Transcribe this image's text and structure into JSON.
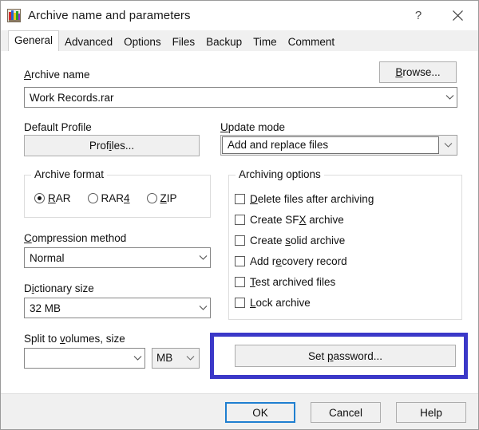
{
  "window": {
    "title": "Archive name and parameters",
    "icon": "winrar-books-icon",
    "help_button": "?",
    "close_button": "✕"
  },
  "tabs": [
    {
      "label": "General",
      "selected": true
    },
    {
      "label": "Advanced",
      "selected": false
    },
    {
      "label": "Options",
      "selected": false
    },
    {
      "label": "Files",
      "selected": false
    },
    {
      "label": "Backup",
      "selected": false
    },
    {
      "label": "Time",
      "selected": false
    },
    {
      "label": "Comment",
      "selected": false
    }
  ],
  "general": {
    "archive_name_label": "Archive name",
    "archive_name_value": "Work Records.rar",
    "browse_button": "Browse...",
    "default_profile_label": "Default Profile",
    "profiles_button": "Profiles...",
    "update_mode_label": "Update mode",
    "update_mode_value": "Add and replace files",
    "archive_format_group": "Archive format",
    "archive_format_options": [
      {
        "label": "RAR",
        "selected": true
      },
      {
        "label": "RAR4",
        "selected": false
      },
      {
        "label": "ZIP",
        "selected": false
      }
    ],
    "compression_method_label": "Compression method",
    "compression_method_value": "Normal",
    "dictionary_size_label": "Dictionary size",
    "dictionary_size_value": "32 MB",
    "split_volumes_label": "Split to volumes, size",
    "split_volumes_value": "",
    "split_volumes_unit": "MB",
    "archiving_options_group": "Archiving options",
    "archiving_options": [
      {
        "label": "Delete files after archiving",
        "checked": false
      },
      {
        "label": "Create SFX archive",
        "checked": false
      },
      {
        "label": "Create solid archive",
        "checked": false
      },
      {
        "label": "Add recovery record",
        "checked": false
      },
      {
        "label": "Test archived files",
        "checked": false
      },
      {
        "label": "Lock archive",
        "checked": false
      }
    ],
    "set_password_button": "Set password..."
  },
  "footer": {
    "ok_button": "OK",
    "cancel_button": "Cancel",
    "help_button": "Help"
  },
  "colors": {
    "annotation_highlight": "#3b38c8",
    "default_button_focus": "#1f7fd0",
    "dialog_background": "#ffffff",
    "panel_background": "#f0f0f0"
  }
}
